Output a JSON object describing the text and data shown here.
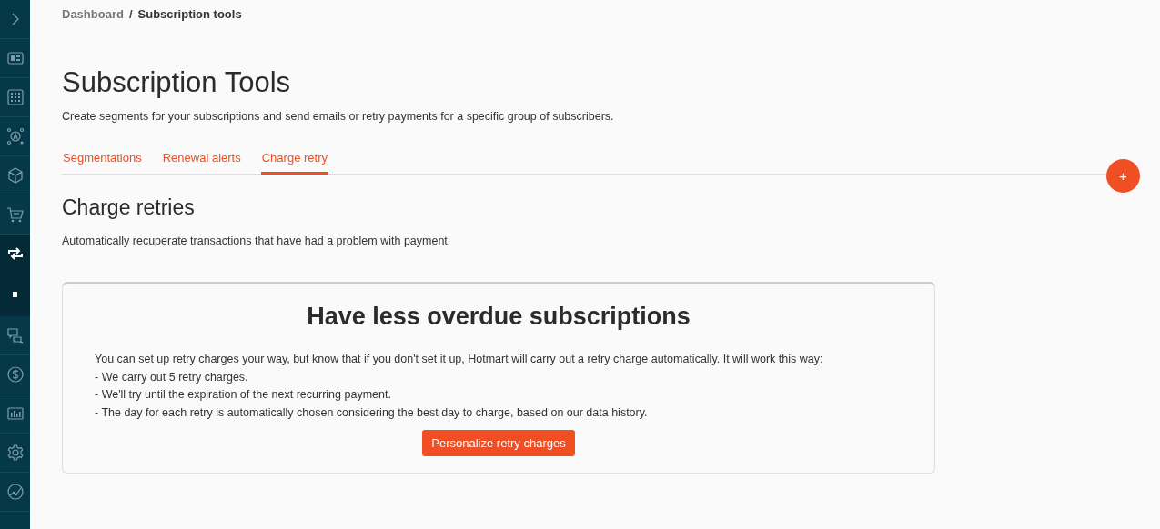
{
  "sidebar": {
    "items": [
      {
        "kind": "toggle",
        "selected": false
      },
      {
        "kind": "nav",
        "selected": false
      },
      {
        "kind": "nav",
        "selected": false
      },
      {
        "kind": "nav",
        "selected": false
      },
      {
        "kind": "nav",
        "selected": false
      },
      {
        "kind": "nav",
        "selected": false
      },
      {
        "kind": "nav",
        "selected": true
      },
      {
        "kind": "subnav",
        "selected": true
      },
      {
        "kind": "nav",
        "selected": false
      },
      {
        "kind": "nav",
        "selected": false
      },
      {
        "kind": "nav",
        "selected": false
      },
      {
        "kind": "nav",
        "selected": false
      },
      {
        "kind": "nav",
        "selected": false
      }
    ]
  },
  "breadcrumb": [
    {
      "label": "Dashboard",
      "current": false
    },
    {
      "label": "Subscription tools",
      "current": true
    }
  ],
  "breadcrumb_separator": "/",
  "page": {
    "title": "Subscription Tools",
    "subtitle": "Create segments for your subscriptions and send emails or retry payments for a specific group of subscribers."
  },
  "tabs": [
    {
      "label": "Segmentations",
      "selected": false
    },
    {
      "label": "Renewal alerts",
      "selected": false
    },
    {
      "label": "Charge retry",
      "selected": true
    }
  ],
  "add_button": {
    "label": "+"
  },
  "section": {
    "title": "Charge retries",
    "description": "Automatically recuperate transactions that have had a problem with payment."
  },
  "card": {
    "title": "Have less overdue subscriptions",
    "intro": "You can set up retry charges your way, but know that if you don't set it up, Hotmart will carry out a retry charge automatically. It will work this way:",
    "points": [
      "- We carry out 5 retry charges.",
      "- We'll try until the expiration of the next recurring payment.",
      "- The day for each retry is automatically chosen considering the best day to charge, based on our data history."
    ],
    "button": "Personalize retry charges"
  }
}
